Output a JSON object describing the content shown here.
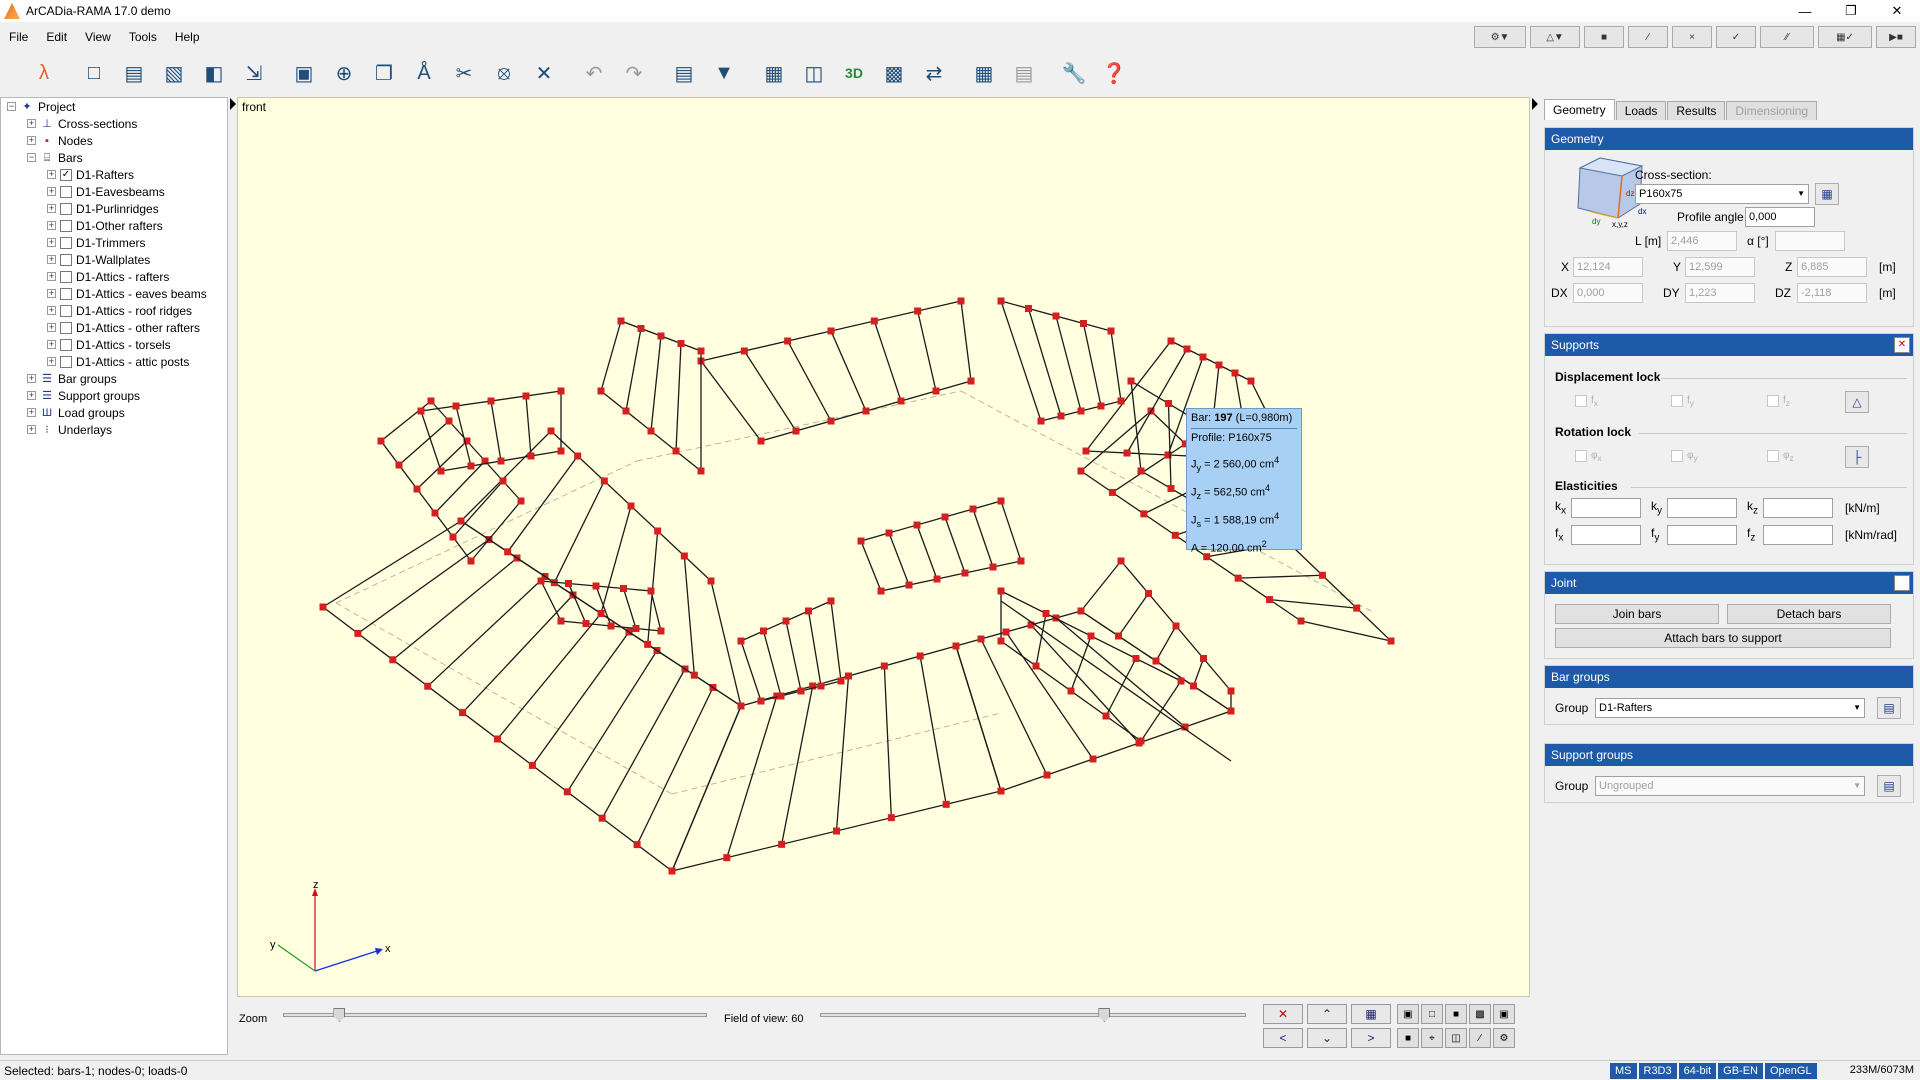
{
  "window": {
    "title": "ArCADia-RAMA 17.0 demo"
  },
  "menu": [
    "File",
    "Edit",
    "View",
    "Tools",
    "Help"
  ],
  "view_label": "front",
  "tree": {
    "root": "Project",
    "items": [
      {
        "label": "Cross-sections",
        "level": 1,
        "icon": "cross-sections-icon",
        "glyph": "⊥"
      },
      {
        "label": "Nodes",
        "level": 1,
        "icon": "nodes-icon",
        "glyph": "▪"
      },
      {
        "label": "Bars",
        "level": 1,
        "icon": "bars-icon",
        "glyph": "⌸"
      }
    ],
    "bars": [
      "D1-Rafters",
      "D1-Eavesbeams",
      "D1-Purlinridges",
      "D1-Other rafters",
      "D1-Trimmers",
      "D1-Wallplates",
      "D1-Attics - rafters",
      "D1-Attics - eaves beams",
      "D1-Attics - roof ridges",
      "D1-Attics - other rafters",
      "D1-Attics - torsels",
      "D1-Attics - attic posts"
    ],
    "groups": [
      {
        "label": "Bar groups",
        "icon": "bar-groups-icon",
        "glyph": "☰"
      },
      {
        "label": "Support groups",
        "icon": "support-groups-icon",
        "glyph": "☰"
      },
      {
        "label": "Load groups",
        "icon": "load-groups-icon",
        "glyph": "Ш"
      },
      {
        "label": "Underlays",
        "icon": "underlays-icon",
        "glyph": "⁝"
      }
    ]
  },
  "tooltip": {
    "bar_prefix": "Bar:",
    "bar_number": "197",
    "bar_length": "(L=0,980m)",
    "profile": "Profile: P160x75",
    "jy": "J",
    "jy_sub": "y",
    "jy_val": " = 2 560,00 cm",
    "jz_sub": "z",
    "jz_val": " = 562,50 cm",
    "js_sub": "s",
    "js_val": " = 1 588,19 cm",
    "exp4": "4",
    "a_label": "A = 120,00 cm",
    "exp2": "2"
  },
  "zoom": {
    "label": "Zoom",
    "value": 0.12,
    "fov_label": "Field of view: 60",
    "fov_value": 0.67
  },
  "tabs": [
    {
      "label": "Geometry",
      "state": "active"
    },
    {
      "label": "Loads",
      "state": "normal"
    },
    {
      "label": "Results",
      "state": "normal"
    },
    {
      "label": "Dimensioning",
      "state": "disabled"
    }
  ],
  "geometry": {
    "title": "Geometry",
    "cross_section_label": "Cross-section:",
    "cross_section_value": "P160x75",
    "profile_angle_label": "Profile angle [°]",
    "profile_angle_value": "0,000",
    "l_label": "L [m]",
    "l_value": "2,446",
    "alpha_label": "α [°]",
    "alpha_value": "",
    "x_label": "X",
    "x_value": "12,124",
    "y_label": "Y",
    "y_value": "12,599",
    "z_label": "Z",
    "z_value": "6,885",
    "dx_label": "DX",
    "dx_value": "0,000",
    "dy_label": "DY",
    "dy_value": "1,223",
    "dz_label": "DZ",
    "dz_value": "-2,118",
    "unit": "[m]",
    "cube_labels": {
      "dz": "dz",
      "dy": "dy",
      "dx": "dx",
      "xyz": "x,y,z"
    }
  },
  "supports": {
    "title": "Supports",
    "displacement_lock": "Displacement lock",
    "rotation_lock": "Rotation lock",
    "elasticities": "Elasticities",
    "fx": "f",
    "fy": "f",
    "fz": "f",
    "px": "φ",
    "py": "φ",
    "pz": "φ",
    "k": "k",
    "f": "f",
    "sub_x": "x",
    "sub_y": "y",
    "sub_z": "z",
    "unit_k": "[kN/m]",
    "unit_f": "[kNm/rad]"
  },
  "joint": {
    "title": "Joint",
    "join": "Join bars",
    "detach": "Detach bars",
    "attach": "Attach bars to support"
  },
  "bar_groups": {
    "title": "Bar groups",
    "group_label": "Group",
    "group_value": "D1-Rafters"
  },
  "support_groups": {
    "title": "Support groups",
    "group_label": "Group",
    "group_value": "Ungrouped"
  },
  "status": {
    "text": "Selected: bars-1; nodes-0; loads-0",
    "badges": [
      "MS",
      "R3D3",
      "64-bit",
      "GB-EN",
      "OpenGL"
    ],
    "memory": "233M/6073M"
  },
  "axes": {
    "x": "x",
    "y": "y",
    "z": "z"
  },
  "colors": {
    "node": "#d42020",
    "accent": "#1e5aa8",
    "viewport": "#ffffe0"
  }
}
